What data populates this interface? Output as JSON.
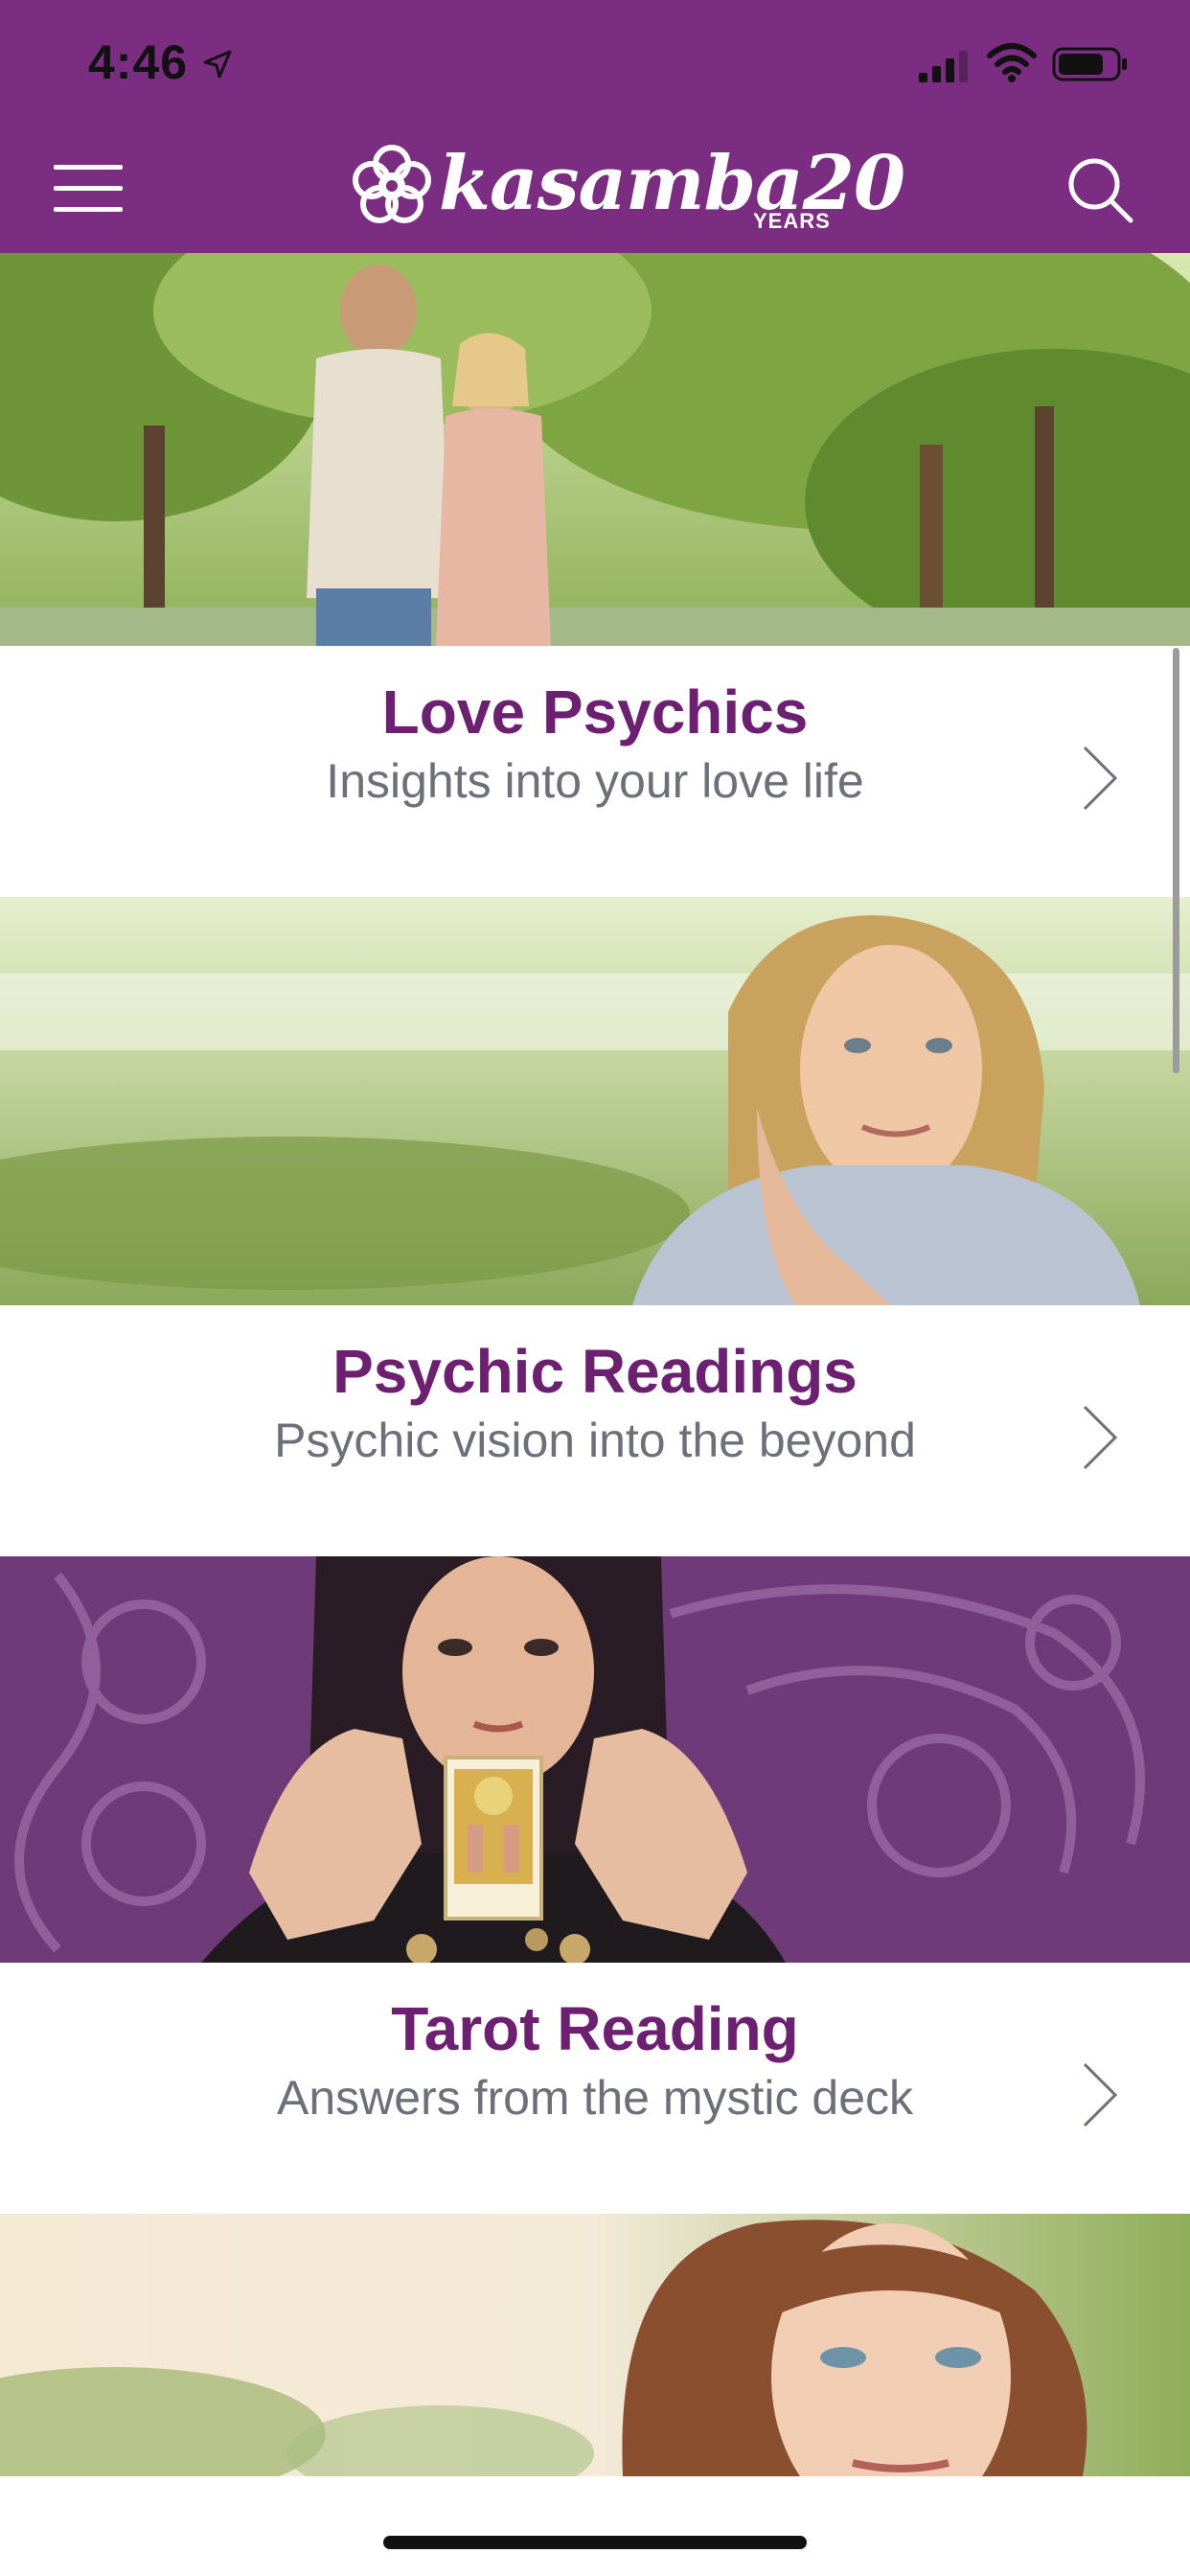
{
  "status_bar": {
    "time": "4:46"
  },
  "header": {
    "logo_word": "kasamba20",
    "logo_years": "YEARS"
  },
  "categories": [
    {
      "title": "Love Psychics",
      "subtitle": "Insights into your love life"
    },
    {
      "title": "Psychic Readings",
      "subtitle": "Psychic vision into the beyond"
    },
    {
      "title": "Tarot Reading",
      "subtitle": "Answers from the mystic deck"
    }
  ],
  "colors": {
    "brand_purple": "#7b2d82",
    "title_purple": "#6d1f72",
    "subtitle_gray": "#6f6f7c"
  },
  "icons": {
    "menu": "hamburger-icon",
    "search": "search-icon",
    "chevron": "chevron-right-icon",
    "brand": "flower-logo-icon"
  }
}
